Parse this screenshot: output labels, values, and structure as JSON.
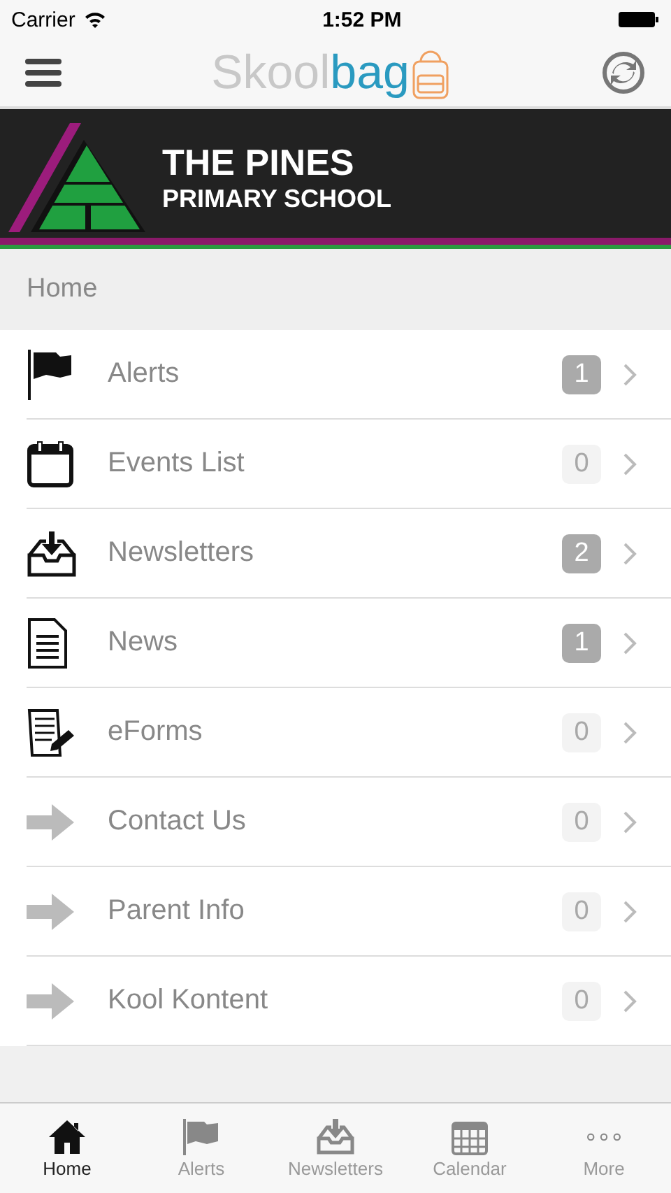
{
  "status_bar": {
    "carrier": "Carrier",
    "time": "1:52 PM"
  },
  "nav": {
    "logo_light": "Skool",
    "logo_dark": "bag"
  },
  "banner": {
    "title": "THE PINES",
    "subtitle": "PRIMARY SCHOOL"
  },
  "section": "Home",
  "items": [
    {
      "kind": "flag",
      "label": "Alerts",
      "count": "1",
      "highlighted": true
    },
    {
      "kind": "calendar",
      "label": "Events List",
      "count": "0",
      "highlighted": false
    },
    {
      "kind": "inbox",
      "label": "Newsletters",
      "count": "2",
      "highlighted": true
    },
    {
      "kind": "document",
      "label": "News",
      "count": "1",
      "highlighted": true
    },
    {
      "kind": "form",
      "label": "eForms",
      "count": "0",
      "highlighted": false
    },
    {
      "kind": "arrow",
      "label": "Contact Us",
      "count": "0",
      "highlighted": false
    },
    {
      "kind": "arrow",
      "label": "Parent Info",
      "count": "0",
      "highlighted": false
    },
    {
      "kind": "arrow",
      "label": "Kool Kontent",
      "count": "0",
      "highlighted": false
    }
  ],
  "tabs": [
    {
      "kind": "home",
      "label": "Home",
      "selected": true
    },
    {
      "kind": "flag",
      "label": "Alerts",
      "selected": false
    },
    {
      "kind": "inbox",
      "label": "Newsletters",
      "selected": false
    },
    {
      "kind": "calendar",
      "label": "Calendar",
      "selected": false
    },
    {
      "kind": "more",
      "label": "More",
      "selected": false
    }
  ]
}
